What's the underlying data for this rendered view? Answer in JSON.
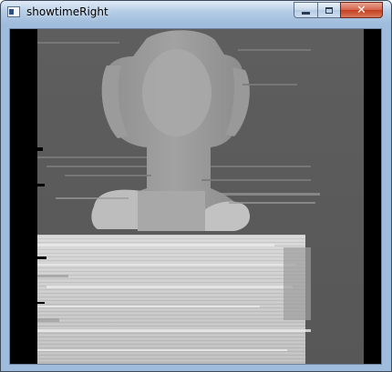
{
  "window": {
    "title": "showtimeRight",
    "title_icon": "app-window-icon"
  },
  "controls": {
    "minimize_icon": "minimize-icon",
    "maximize_icon": "maximize-icon",
    "close_icon": "close-icon"
  },
  "image": {
    "subject": "disparity-map",
    "colors": {
      "background_gray": "#5c5c5c",
      "shoulder_light": "#bcbcbc",
      "table_light": "#d0d0d0",
      "border_black": "#000000"
    }
  }
}
